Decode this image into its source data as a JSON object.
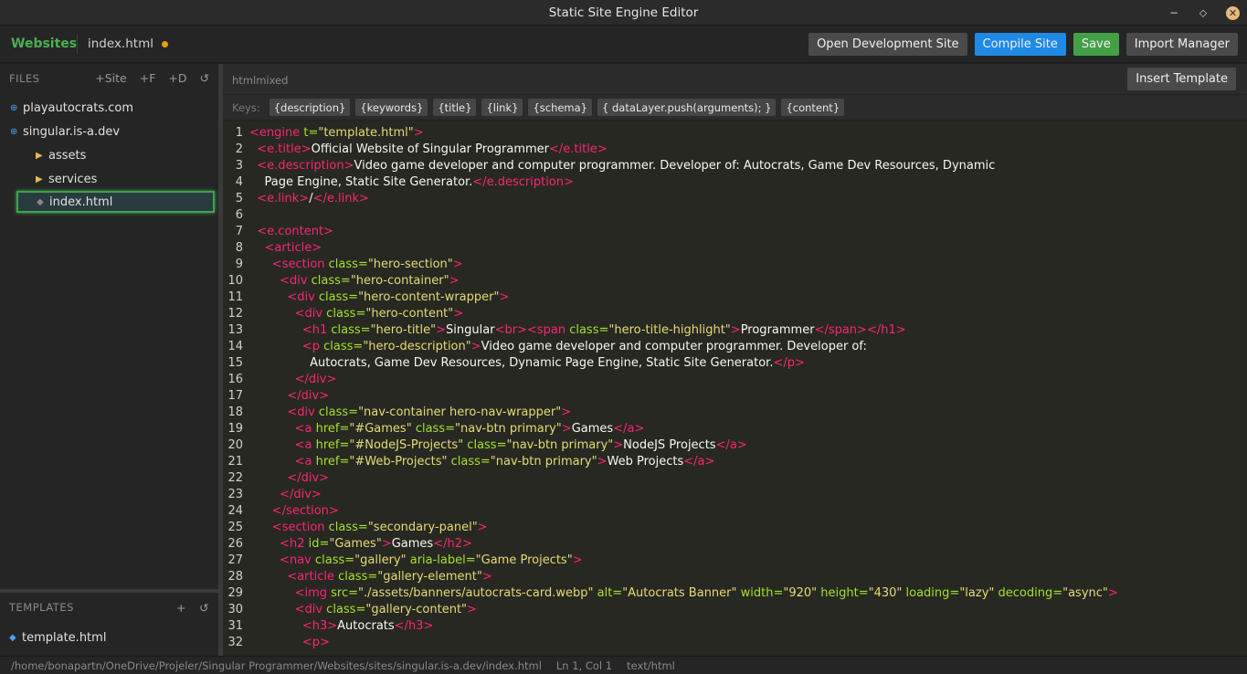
{
  "window": {
    "title": "Static Site Engine Editor",
    "minimize": "−",
    "maximize": "⬦",
    "close": "✕"
  },
  "toolbar": {
    "brand": "Websites",
    "current_file": "index.html",
    "buttons": {
      "open_dev": "Open Development Site",
      "compile": "Compile Site",
      "save": "Save",
      "import": "Import Manager"
    }
  },
  "files": {
    "header": "FILES",
    "actions": {
      "add_site": "+Site",
      "add_file": "+F",
      "add_dir": "+D",
      "refresh": "↺"
    },
    "items": [
      {
        "label": "playautocrats.com",
        "icon": "globe-icon"
      },
      {
        "label": "singular.is-a.dev",
        "icon": "globe-icon"
      },
      {
        "label": "assets",
        "icon": "folder-icon"
      },
      {
        "label": "services",
        "icon": "folder-icon"
      },
      {
        "label": "index.html",
        "icon": "file-icon"
      }
    ]
  },
  "templates": {
    "header": "TEMPLATES",
    "actions": {
      "add": "+",
      "refresh": "↺"
    },
    "items": [
      {
        "label": "template.html",
        "icon": "template-icon"
      }
    ]
  },
  "editor": {
    "mode": "htmlmixed",
    "insert_template": "Insert Template",
    "keys_label": "Keys:",
    "keys": [
      "{description}",
      "{keywords}",
      "{title}",
      "{link}",
      "{schema}",
      "{ dataLayer.push(arguments); }",
      "{content}"
    ],
    "lines": [
      [
        [
          "t",
          "<engine"
        ],
        [
          "a",
          " t="
        ],
        [
          "s",
          "\"template.html\""
        ],
        [
          "t",
          ">"
        ]
      ],
      [
        [
          "p",
          "  "
        ],
        [
          "t",
          "<e.title>"
        ],
        [
          "p",
          "Official Website of Singular Programmer"
        ],
        [
          "t",
          "</e.title>"
        ]
      ],
      [
        [
          "p",
          "  "
        ],
        [
          "t",
          "<e.description>"
        ],
        [
          "p",
          "Video game developer and computer programmer. Developer of: Autocrats, Game Dev Resources, Dynamic"
        ]
      ],
      [
        [
          "p",
          "    Page Engine, Static Site Generator."
        ],
        [
          "t",
          "</e.description>"
        ]
      ],
      [
        [
          "p",
          "  "
        ],
        [
          "t",
          "<e.link>"
        ],
        [
          "p",
          "/"
        ],
        [
          "t",
          "</e.link>"
        ]
      ],
      [],
      [
        [
          "p",
          "  "
        ],
        [
          "t",
          "<e.content>"
        ]
      ],
      [
        [
          "p",
          "    "
        ],
        [
          "t",
          "<article>"
        ]
      ],
      [
        [
          "p",
          "      "
        ],
        [
          "t",
          "<section"
        ],
        [
          "a",
          " class="
        ],
        [
          "s",
          "\"hero-section\""
        ],
        [
          "t",
          ">"
        ]
      ],
      [
        [
          "p",
          "        "
        ],
        [
          "t",
          "<div"
        ],
        [
          "a",
          " class="
        ],
        [
          "s",
          "\"hero-container\""
        ],
        [
          "t",
          ">"
        ]
      ],
      [
        [
          "p",
          "          "
        ],
        [
          "t",
          "<div"
        ],
        [
          "a",
          " class="
        ],
        [
          "s",
          "\"hero-content-wrapper\""
        ],
        [
          "t",
          ">"
        ]
      ],
      [
        [
          "p",
          "            "
        ],
        [
          "t",
          "<div"
        ],
        [
          "a",
          " class="
        ],
        [
          "s",
          "\"hero-content\""
        ],
        [
          "t",
          ">"
        ]
      ],
      [
        [
          "p",
          "              "
        ],
        [
          "t",
          "<h1"
        ],
        [
          "a",
          " class="
        ],
        [
          "s",
          "\"hero-title\""
        ],
        [
          "t",
          ">"
        ],
        [
          "p",
          "Singular"
        ],
        [
          "t",
          "<br><span"
        ],
        [
          "a",
          " class="
        ],
        [
          "s",
          "\"hero-title-highlight\""
        ],
        [
          "t",
          ">"
        ],
        [
          "p",
          "Programmer"
        ],
        [
          "t",
          "</span></h1>"
        ]
      ],
      [
        [
          "p",
          "              "
        ],
        [
          "t",
          "<p"
        ],
        [
          "a",
          " class="
        ],
        [
          "s",
          "\"hero-description\""
        ],
        [
          "t",
          ">"
        ],
        [
          "p",
          "Video game developer and computer programmer. Developer of:"
        ]
      ],
      [
        [
          "p",
          "                Autocrats, Game Dev Resources, Dynamic Page Engine, Static Site Generator."
        ],
        [
          "t",
          "</p>"
        ]
      ],
      [
        [
          "p",
          "            "
        ],
        [
          "t",
          "</div>"
        ]
      ],
      [
        [
          "p",
          "          "
        ],
        [
          "t",
          "</div>"
        ]
      ],
      [
        [
          "p",
          "          "
        ],
        [
          "t",
          "<div"
        ],
        [
          "a",
          " class="
        ],
        [
          "s",
          "\"nav-container hero-nav-wrapper\""
        ],
        [
          "t",
          ">"
        ]
      ],
      [
        [
          "p",
          "            "
        ],
        [
          "t",
          "<a"
        ],
        [
          "a",
          " href="
        ],
        [
          "s",
          "\"#Games\""
        ],
        [
          "a",
          " class="
        ],
        [
          "s",
          "\"nav-btn primary\""
        ],
        [
          "t",
          ">"
        ],
        [
          "p",
          "Games"
        ],
        [
          "t",
          "</a>"
        ]
      ],
      [
        [
          "p",
          "            "
        ],
        [
          "t",
          "<a"
        ],
        [
          "a",
          " href="
        ],
        [
          "s",
          "\"#NodeJS-Projects\""
        ],
        [
          "a",
          " class="
        ],
        [
          "s",
          "\"nav-btn primary\""
        ],
        [
          "t",
          ">"
        ],
        [
          "p",
          "NodeJS Projects"
        ],
        [
          "t",
          "</a>"
        ]
      ],
      [
        [
          "p",
          "            "
        ],
        [
          "t",
          "<a"
        ],
        [
          "a",
          " href="
        ],
        [
          "s",
          "\"#Web-Projects\""
        ],
        [
          "a",
          " class="
        ],
        [
          "s",
          "\"nav-btn primary\""
        ],
        [
          "t",
          ">"
        ],
        [
          "p",
          "Web Projects"
        ],
        [
          "t",
          "</a>"
        ]
      ],
      [
        [
          "p",
          "          "
        ],
        [
          "t",
          "</div>"
        ]
      ],
      [
        [
          "p",
          "        "
        ],
        [
          "t",
          "</div>"
        ]
      ],
      [
        [
          "p",
          "      "
        ],
        [
          "t",
          "</section>"
        ]
      ],
      [
        [
          "p",
          "      "
        ],
        [
          "t",
          "<section"
        ],
        [
          "a",
          " class="
        ],
        [
          "s",
          "\"secondary-panel\""
        ],
        [
          "t",
          ">"
        ]
      ],
      [
        [
          "p",
          "        "
        ],
        [
          "t",
          "<h2"
        ],
        [
          "a",
          " id="
        ],
        [
          "s",
          "\"Games\""
        ],
        [
          "t",
          ">"
        ],
        [
          "p",
          "Games"
        ],
        [
          "t",
          "</h2>"
        ]
      ],
      [
        [
          "p",
          "        "
        ],
        [
          "t",
          "<nav"
        ],
        [
          "a",
          " class="
        ],
        [
          "s",
          "\"gallery\""
        ],
        [
          "a",
          " aria-label="
        ],
        [
          "s",
          "\"Game Projects\""
        ],
        [
          "t",
          ">"
        ]
      ],
      [
        [
          "p",
          "          "
        ],
        [
          "t",
          "<article"
        ],
        [
          "a",
          " class="
        ],
        [
          "s",
          "\"gallery-element\""
        ],
        [
          "t",
          ">"
        ]
      ],
      [
        [
          "p",
          "            "
        ],
        [
          "t",
          "<img"
        ],
        [
          "a",
          " src="
        ],
        [
          "s",
          "\"./assets/banners/autocrats-card.webp\""
        ],
        [
          "a",
          " alt="
        ],
        [
          "s",
          "\"Autocrats Banner\""
        ],
        [
          "a",
          " width="
        ],
        [
          "s",
          "\"920\""
        ],
        [
          "a",
          " height="
        ],
        [
          "s",
          "\"430\""
        ],
        [
          "a",
          " loading="
        ],
        [
          "s",
          "\"lazy\""
        ],
        [
          "a",
          " decoding="
        ],
        [
          "s",
          "\"async\""
        ],
        [
          "t",
          ">"
        ]
      ],
      [
        [
          "p",
          "            "
        ],
        [
          "t",
          "<div"
        ],
        [
          "a",
          " class="
        ],
        [
          "s",
          "\"gallery-content\""
        ],
        [
          "t",
          ">"
        ]
      ],
      [
        [
          "p",
          "              "
        ],
        [
          "t",
          "<h3>"
        ],
        [
          "p",
          "Autocrats"
        ],
        [
          "t",
          "</h3>"
        ]
      ],
      [
        [
          "p",
          "              "
        ],
        [
          "t",
          "<p>"
        ]
      ]
    ]
  },
  "status": {
    "path": "/home/bonapartn/OneDrive/Projeler/Singular Programmer/Websites/sites/singular.is-a.dev/index.html",
    "cursor": "Ln 1, Col 1",
    "mime": "text/html"
  }
}
